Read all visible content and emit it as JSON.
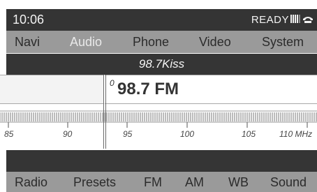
{
  "status": {
    "time": "10:06",
    "ready_label": "READY"
  },
  "main_menu": [
    {
      "label": "Navi",
      "active": false
    },
    {
      "label": "Audio",
      "active": true
    },
    {
      "label": "Phone",
      "active": false
    },
    {
      "label": "Video",
      "active": false
    },
    {
      "label": "System",
      "active": false
    }
  ],
  "station_name": "98.7Kiss",
  "tuner": {
    "preset_number": "0",
    "frequency": "98.7 FM",
    "scale_labels": [
      "85",
      "90",
      "95",
      "100",
      "105",
      "110 MHz"
    ]
  },
  "sub_menu": [
    {
      "label": "Radio"
    },
    {
      "label": "Presets"
    },
    {
      "label": "FM"
    },
    {
      "label": "AM"
    },
    {
      "label": "WB"
    },
    {
      "label": "Sound"
    }
  ],
  "colors": {
    "bar_dark": "#353535",
    "menu_bg": "#9a9a9a",
    "active_text": "#e9e9e9",
    "panel_bg": "#f3f3f3"
  }
}
